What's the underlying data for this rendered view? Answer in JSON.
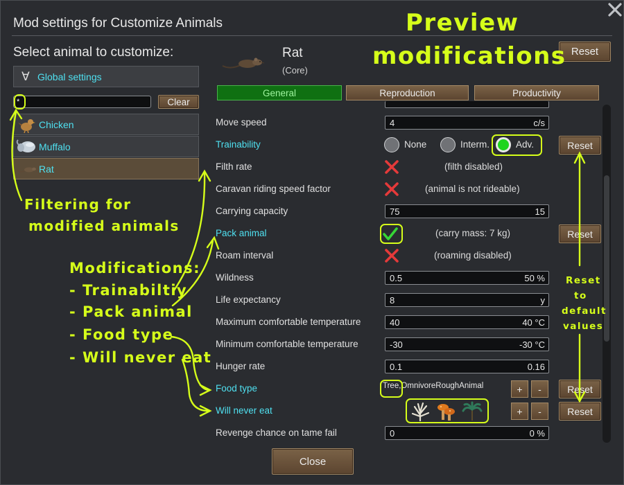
{
  "window": {
    "title": "Mod settings for Customize Animals",
    "close_icon": "close-x-icon"
  },
  "left_panel": {
    "header": "Select animal to customize:",
    "global_icon": "∀",
    "global_label": "Global settings",
    "search_value": "*",
    "clear_label": "Clear",
    "animals": [
      {
        "name": "Chicken",
        "icon": "chicken-icon"
      },
      {
        "name": "Muffalo",
        "icon": "muffalo-icon"
      },
      {
        "name": "Rat",
        "icon": "rat-icon",
        "selected": true
      }
    ]
  },
  "selected_animal": {
    "name": "Rat",
    "source": "(Core)",
    "icon": "rat-icon"
  },
  "reset_top_label": "Reset",
  "tabs": [
    {
      "label": "General",
      "active": true
    },
    {
      "label": "Reproduction",
      "active": false
    },
    {
      "label": "Productivity",
      "active": false
    }
  ],
  "properties": {
    "move_speed": {
      "label": "Move speed",
      "value": "4",
      "unit": "c/s"
    },
    "trainability": {
      "label": "Trainability",
      "options": [
        "None",
        "Interm.",
        "Adv."
      ],
      "selected": "Adv.",
      "reset": "Reset"
    },
    "filth_rate": {
      "label": "Filth rate",
      "note": "(filth disabled)"
    },
    "caravan": {
      "label": "Caravan riding speed factor",
      "note": "(animal is not rideable)"
    },
    "carrying": {
      "label": "Carrying capacity",
      "value": "75",
      "unit": "15"
    },
    "pack_animal": {
      "label": "Pack animal",
      "note": "(carry mass: 7 kg)",
      "reset": "Reset"
    },
    "roam": {
      "label": "Roam interval",
      "note": "(roaming disabled)"
    },
    "wildness": {
      "label": "Wildness",
      "value": "0.5",
      "unit": "50 %"
    },
    "life": {
      "label": "Life expectancy",
      "value": "8",
      "unit": "y"
    },
    "max_temp": {
      "label": "Maximum comfortable temperature",
      "value": "40",
      "unit": "40 °C"
    },
    "min_temp": {
      "label": "Minimum comfortable temperature",
      "value": "-30",
      "unit": "-30 °C"
    },
    "hunger": {
      "label": "Hunger rate",
      "value": "0.1",
      "unit": "0.16"
    },
    "food_type": {
      "label": "Food type",
      "prefix": "Tree,",
      "value": "OmnivoreRoughAnimal",
      "plus": "+",
      "minus": "-",
      "reset": "Reset"
    },
    "never_eat": {
      "label": "Will never eat",
      "plus": "+",
      "minus": "-",
      "reset": "Reset",
      "icons": [
        "white-plant-icon",
        "orange-mushroom-icon",
        "palm-plant-icon"
      ]
    },
    "revenge": {
      "label": "Revenge chance on tame fail",
      "value": "0",
      "unit": "0 %"
    }
  },
  "close_label": "Close",
  "annotations": {
    "preview_line1": "Preview",
    "preview_line2": "modifications",
    "filtering_line1": "Filtering for",
    "filtering_line2": "modified animals",
    "mods_header": "Modifications:",
    "mods_items": [
      "- Trainabiltiy",
      "- Pack animal",
      "- Food type",
      "- Will never eat"
    ],
    "reset_line1": "Reset",
    "reset_line2": "to",
    "reset_line3": "default",
    "reset_line4": "values",
    "color": "#d6ff1a"
  }
}
